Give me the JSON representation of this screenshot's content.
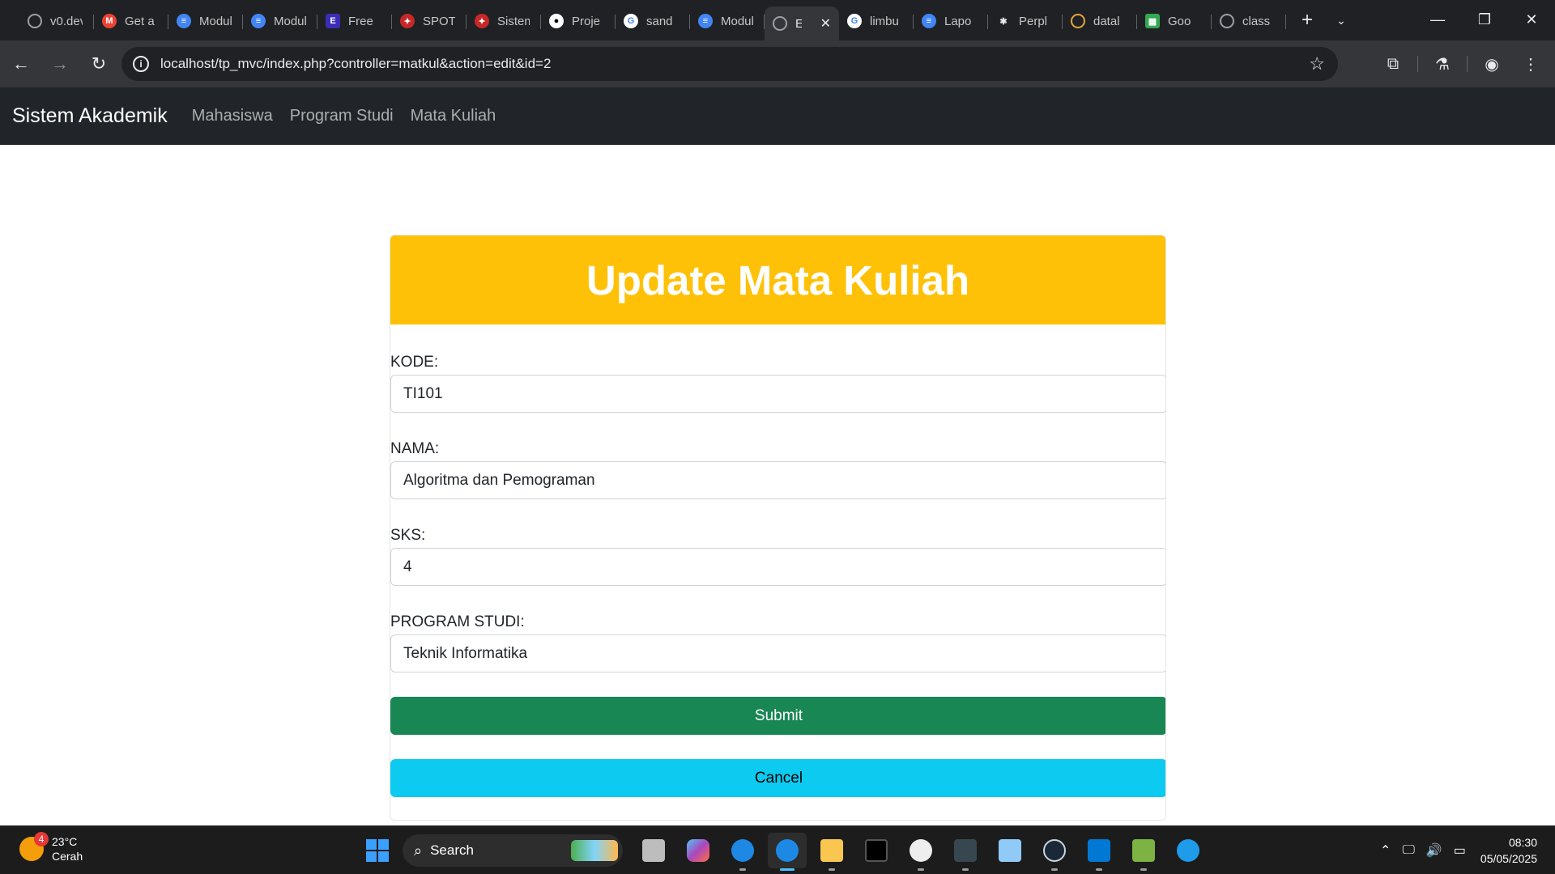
{
  "browser": {
    "tabs": [
      {
        "title": "v0.dev",
        "icon": "globe-icon",
        "color": "#9aa0a6"
      },
      {
        "title": "Get a",
        "icon": "gmail-icon",
        "color": "#ea4335"
      },
      {
        "title": "Modul",
        "icon": "doc-icon",
        "color": "#4285f4"
      },
      {
        "title": "Modul",
        "icon": "doc-icon",
        "color": "#4285f4"
      },
      {
        "title": "Free",
        "icon": "e-icon",
        "color": "#3b2db5"
      },
      {
        "title": "SPOT",
        "icon": "university-icon",
        "color": "#c62828"
      },
      {
        "title": "Sistem",
        "icon": "university-icon",
        "color": "#c62828"
      },
      {
        "title": "Proje",
        "icon": "github-icon",
        "color": "#ffffff"
      },
      {
        "title": "sand",
        "icon": "google-icon",
        "color": "#4285f4"
      },
      {
        "title": "Modul",
        "icon": "doc-icon",
        "color": "#4285f4"
      },
      {
        "title": "E",
        "icon": "globe-icon",
        "color": "#9aa0a6",
        "active": true
      },
      {
        "title": "limbu",
        "icon": "google-icon",
        "color": "#4285f4"
      },
      {
        "title": "Lapo",
        "icon": "doc-icon",
        "color": "#4285f4"
      },
      {
        "title": "Perpl",
        "icon": "perplexity-icon",
        "color": "#e8eaed"
      },
      {
        "title": "datal",
        "icon": "kaggle-icon",
        "color": "#e8a33d"
      },
      {
        "title": "Goo",
        "icon": "sheets-icon",
        "color": "#34a853"
      },
      {
        "title": "class",
        "icon": "globe-icon",
        "color": "#9aa0a6"
      }
    ],
    "url": "localhost/tp_mvc/index.php?controller=matkul&action=edit&id=2"
  },
  "navbar": {
    "brand": "Sistem Akademik",
    "links": [
      "Mahasiswa",
      "Program Studi",
      "Mata Kuliah"
    ]
  },
  "form": {
    "title": "Update Mata Kuliah",
    "fields": [
      {
        "label": "KODE:",
        "value": "TI101"
      },
      {
        "label": "NAMA:",
        "value": "Algoritma dan Pemograman"
      },
      {
        "label": "SKS:",
        "value": "4"
      },
      {
        "label": "PROGRAM STUDI:",
        "value": "Teknik Informatika"
      }
    ],
    "submit_label": "Submit",
    "cancel_label": "Cancel",
    "colors": {
      "header": "#ffc107",
      "submit": "#198754",
      "cancel": "#0dcaf0"
    }
  },
  "taskbar": {
    "weather": {
      "temp": "23°C",
      "desc": "Cerah",
      "badge": "4"
    },
    "search_label": "Search",
    "time": "08:30",
    "date": "05/05/2025"
  }
}
